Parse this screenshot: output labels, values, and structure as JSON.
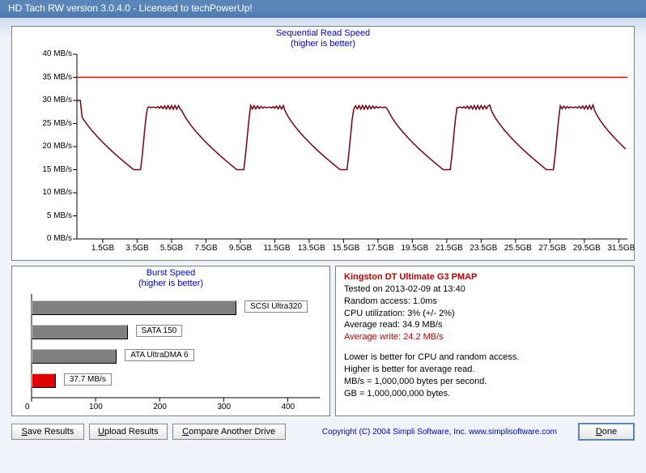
{
  "window_title": "HD Tach RW version 3.0.4.0 - Licensed to techPowerUp!",
  "seq_chart": {
    "title_line1": "Sequential Read Speed",
    "title_line2": "(higher is better)"
  },
  "burst_chart": {
    "title_line1": "Burst Speed",
    "title_line2": "(higher is better)"
  },
  "info": {
    "device": "Kingston DT Ultimate G3 PMAP",
    "tested": "Tested on 2013-02-09 at 13:40",
    "random_access": "Random access: 1.0ms",
    "cpu": "CPU utilization: 3% (+/- 2%)",
    "avg_read": "Average read: 34.9 MB/s",
    "avg_write": "Average write: 24.2 MB/s",
    "note1": "Lower is better for CPU and random access.",
    "note2": "Higher is better for average read.",
    "note3": "MB/s = 1,000,000 bytes per second.",
    "note4": "GB = 1,000,000,000 bytes."
  },
  "burst_bars": {
    "scsi": "SCSI Ultra320",
    "sata": "SATA 150",
    "ata": "ATA UltraDMA 6",
    "measured": "37.7 MB/s"
  },
  "buttons": {
    "save": "ave Results",
    "upload": "pload Results",
    "compare": "ompare Another Drive",
    "done": "one"
  },
  "copyright": "Copyright (C) 2004 Simpli Software, Inc.  www.simplisoftware.com",
  "chart_data": {
    "sequential_read": {
      "type": "line",
      "xlabel": "GB",
      "ylabel": "MB/s",
      "x_ticks": [
        1.5,
        3.5,
        5.5,
        7.5,
        9.5,
        11.5,
        13.5,
        15.5,
        17.5,
        19.5,
        21.5,
        23.5,
        25.5,
        27.5,
        29.5,
        31.5
      ],
      "y_ticks": [
        0,
        5,
        10,
        15,
        20,
        25,
        30,
        35,
        40
      ],
      "ylim": [
        0,
        40
      ],
      "series": [
        {
          "name": "burst",
          "color": "#ff0000",
          "constant_value": 35
        },
        {
          "name": "read",
          "color": "#8b0000",
          "approx_pattern": "sawtooth",
          "period_gb": 6.0,
          "min_mb_s": 15,
          "max_mb_s": 29,
          "start_mb_s": 30
        }
      ]
    },
    "burst_speed": {
      "type": "bar",
      "orientation": "horizontal",
      "xlabel": "MB/s",
      "x_ticks": [
        0,
        100,
        200,
        300,
        400
      ],
      "xlim": [
        0,
        450
      ],
      "bars": [
        {
          "name": "SCSI Ultra320",
          "value": 320,
          "color": "#808080"
        },
        {
          "name": "SATA 150",
          "value": 150,
          "color": "#808080"
        },
        {
          "name": "ATA UltraDMA 6",
          "value": 133,
          "color": "#808080"
        },
        {
          "name": "Measured",
          "value": 37.7,
          "color": "#e00000"
        }
      ]
    }
  }
}
